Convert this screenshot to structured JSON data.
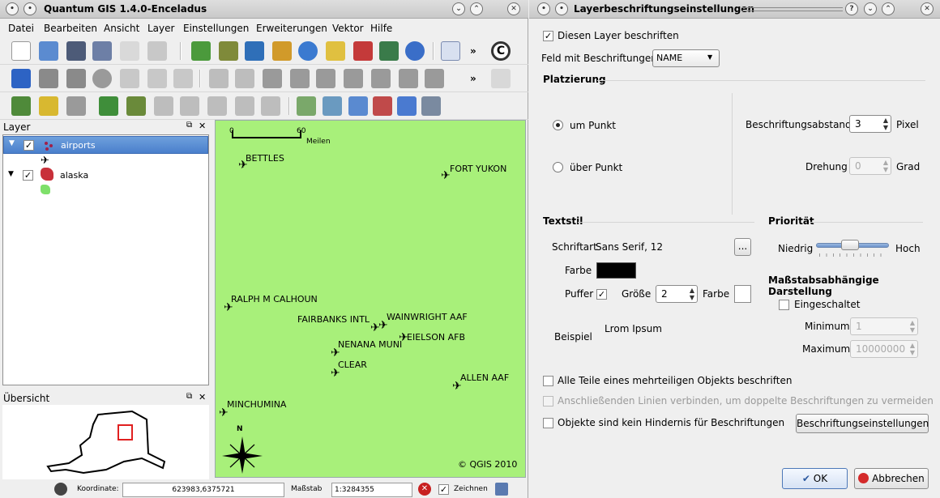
{
  "qgis": {
    "title": "Quantum GIS 1.4.0-Enceladus",
    "menu": [
      "Datei",
      "Bearbeiten",
      "Ansicht",
      "Layer",
      "Einstellungen",
      "Erweiterungen",
      "Vektor",
      "Hilfe"
    ],
    "layer_panel": {
      "title": "Layer",
      "layers": [
        {
          "name": "airports",
          "checked": true,
          "selected": true
        },
        {
          "name": "alaska",
          "checked": true,
          "selected": false
        }
      ]
    },
    "overview_panel": {
      "title": "Übersicht"
    },
    "map": {
      "scalebar": {
        "left": "0",
        "right": "60",
        "unit": "Meilen"
      },
      "airports": [
        "BETTLES",
        "FORT YUKON",
        "RALPH M CALHOUN",
        "FAIRBANKS INTL",
        "WAINWRIGHT AAF",
        "EIELSON AFB",
        "NENANA MUNI",
        "CLEAR",
        "ALLEN AAF",
        "MINCHUMINA"
      ],
      "north": "N",
      "copyright": "© QGIS 2010",
      "bg_color": "#a8f07a"
    },
    "status": {
      "coord_label": "Koordinate:",
      "coord_value": "623983,6375721",
      "scale_label": "Maßstab",
      "scale_value": "1:3284355",
      "render_label": "Zeichnen"
    }
  },
  "dialog": {
    "title": "Layerbeschriftungseinstellungen",
    "label_layer": "Diesen Layer beschriften",
    "field_label": "Feld mit Beschriftungen",
    "field_value": "NAME",
    "placement": {
      "title": "Platzierung",
      "around": "um Punkt",
      "over": "über Punkt",
      "distance_label": "Beschriftungsabstand",
      "distance_value": "3",
      "distance_unit": "Pixel",
      "rotation_label": "Drehung",
      "rotation_value": "0",
      "rotation_unit": "Grad"
    },
    "textstyle": {
      "title": "Textstil",
      "font_label": "Schriftart",
      "font_value": "Sans Serif, 12",
      "font_btn": "...",
      "color_label": "Farbe",
      "buffer_label": "Puffer",
      "size_label": "Größe",
      "size_value": "2",
      "buffer_color_label": "Farbe",
      "sample_label": "Beispiel",
      "sample_text": "Lrom Ipsum"
    },
    "priority": {
      "title": "Priorität",
      "low": "Niedrig",
      "high": "Hoch",
      "level": 0.45
    },
    "scale": {
      "title": "Maßstabsabhängige Darstellung",
      "enabled": "Eingeschaltet",
      "min_label": "Minimum",
      "min_value": "1",
      "max_label": "Maximum",
      "max_value": "10000000"
    },
    "opt_all_parts": "Alle Teile eines mehrteiligen Objekts beschriften",
    "opt_merge_lines": "Anschließenden Linien verbinden, um doppelte Beschriftungen zu vermeiden",
    "opt_no_obstacle": "Objekte sind kein Hindernis für Beschriftungen",
    "engine_btn": "Beschriftungseinstellungen",
    "ok": "OK",
    "cancel": "Abbrechen"
  }
}
